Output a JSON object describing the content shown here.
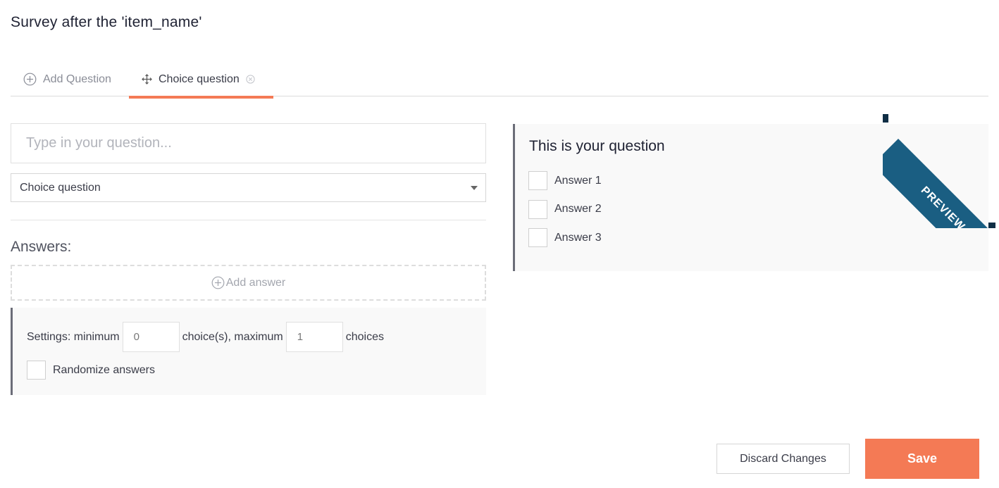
{
  "page": {
    "title": "Survey after the 'item_name'"
  },
  "tabs": [
    {
      "label": "Add Question",
      "icon": "plus-circle-icon"
    },
    {
      "label": "Choice question",
      "icon": "move-icon",
      "close_icon": "close-circle-icon",
      "active": true
    }
  ],
  "editor": {
    "question_placeholder": "Type in your question...",
    "question_value": "",
    "type_select": {
      "selected": "Choice question"
    },
    "answers_label": "Answers:",
    "add_answer_label": "Add answer",
    "settings": {
      "prefix": "Settings: minimum",
      "min_value": "0",
      "middle": "choice(s), maximum",
      "max_value": "1",
      "suffix": "choices",
      "randomize_label": "Randomize answers",
      "randomize_checked": false
    }
  },
  "preview": {
    "ribbon_label": "PREVIEW",
    "question": "This is your question",
    "answers": [
      "Answer 1",
      "Answer 2",
      "Answer 3"
    ]
  },
  "footer": {
    "discard_label": "Discard Changes",
    "save_label": "Save"
  },
  "colors": {
    "accent": "#f47a55",
    "ribbon": "#1a5e82",
    "ribbon_dark": "#0f2e45",
    "panel_border": "#6b6d78",
    "panel_bg": "#f9f9f9"
  }
}
